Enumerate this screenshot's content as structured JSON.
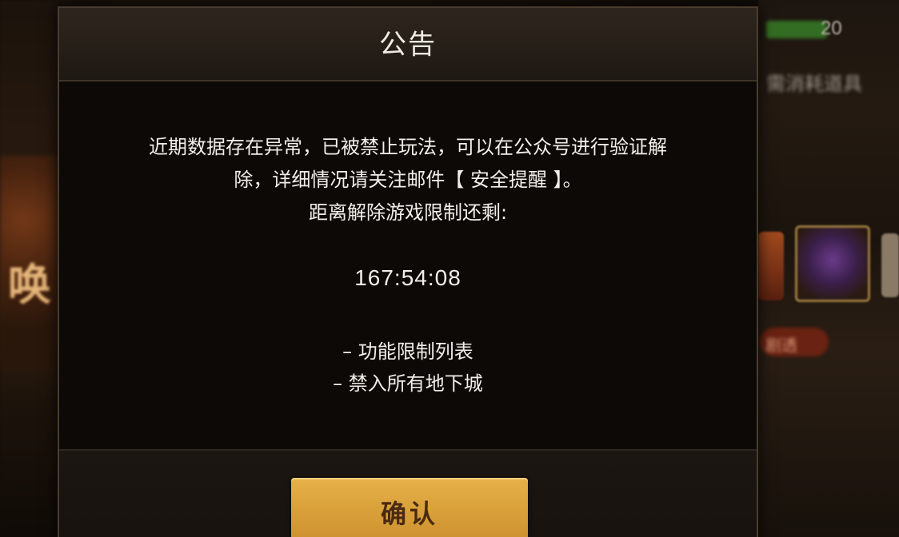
{
  "background": {
    "left_glyph": "唤",
    "right_counter": "20",
    "right_text": "需消耗道具",
    "right_tag": "剧透"
  },
  "dialog": {
    "title": "公告",
    "message_lines": [
      "近期数据存在异常，已被禁止玩法，可以在公众号进行验证解",
      "除，详细情况请关注邮件【 安全提醒 】。",
      "距离解除游戏限制还剩:"
    ],
    "countdown": "167:54:08",
    "restrictions": [
      "– 功能限制列表",
      "– 禁入所有地下城"
    ],
    "confirm_label": "确认"
  },
  "colors": {
    "accent_button": "#d9a03a",
    "text_primary": "#f2eee8",
    "panel_background": "#0c0907"
  }
}
